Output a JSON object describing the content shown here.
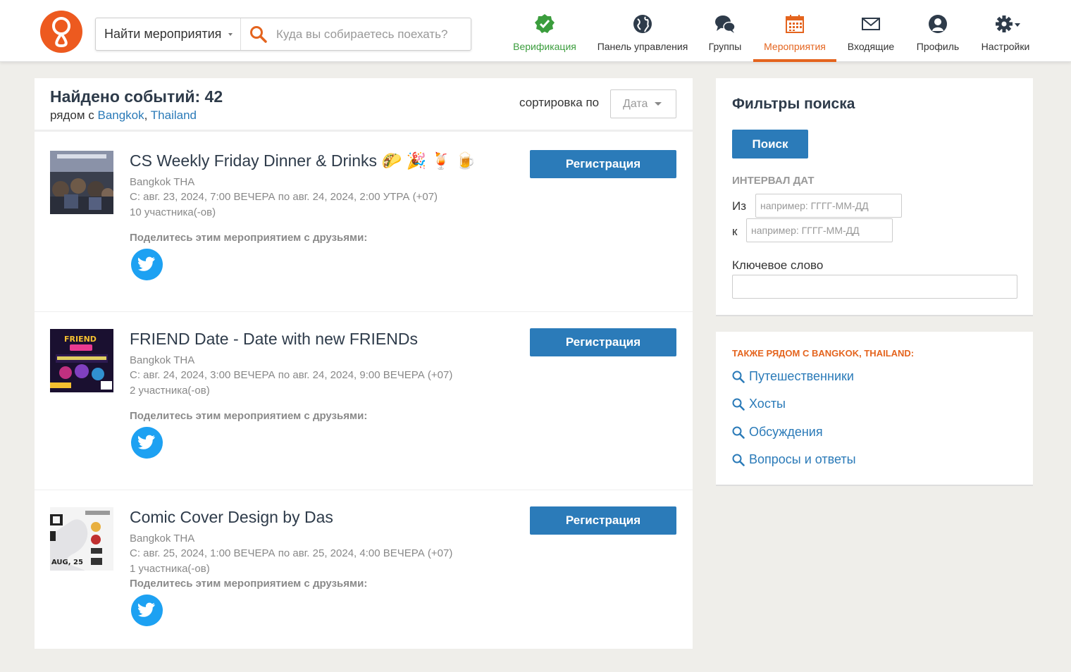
{
  "header": {
    "search_select": "Найти мероприятия",
    "search_placeholder": "Куда вы собираетесь поехать?",
    "nav": [
      {
        "label": "Верификация"
      },
      {
        "label": "Панель управления"
      },
      {
        "label": "Группы"
      },
      {
        "label": "Мероприятия"
      },
      {
        "label": "Входящие"
      },
      {
        "label": "Профиль"
      },
      {
        "label": "Настройки"
      }
    ],
    "colors": {
      "brand": "#ed5a1f",
      "active": "#e4641e",
      "verified": "#3b9d3d",
      "link": "#2a7ab8"
    }
  },
  "results": {
    "title": "Найдено событий: 42",
    "near_prefix": "рядом с ",
    "near_city": "Bangkok",
    "near_sep": ", ",
    "near_country": "Thailand",
    "sort_label": "сортировка по",
    "sort_value": "Дата"
  },
  "events": [
    {
      "title": "CS Weekly Friday Dinner & Drinks 🌮 🎉 🍹 🍺",
      "location": "Bangkok THA",
      "dates": "С: авг. 23, 2024, 7:00 ВЕЧЕРА по авг. 24, 2024, 2:00 УТРА (+07)",
      "attendees": "10 участника(-ов)",
      "share": "Поделитесь этим мероприятием с друзьями:",
      "register": "Регистрация"
    },
    {
      "title": "FRIEND Date - Date with new FRIENDs",
      "location": "Bangkok THA",
      "dates": "С: авг. 24, 2024, 3:00 ВЕЧЕРА по авг. 24, 2024, 9:00 ВЕЧЕРА (+07)",
      "attendees": "2 участника(-ов)",
      "share": "Поделитесь этим мероприятием с друзьями:",
      "register": "Регистрация"
    },
    {
      "title": "Comic Cover Design by Das",
      "location": "Bangkok THA",
      "dates": "С: авг. 25, 2024, 1:00 ВЕЧЕРА по авг. 25, 2024, 4:00 ВЕЧЕРА (+07)",
      "attendees": "1 участника(-ов)",
      "share": "Поделитесь этим мероприятием с друзьями:",
      "register": "Регистрация"
    }
  ],
  "filters": {
    "title": "Фильтры поиска",
    "search_button": "Поиск",
    "date_interval": "ИНТЕРВАЛ ДАТ",
    "from_label": "Из",
    "to_label": "к",
    "date_placeholder": "например: ГГГГ-ММ-ДД",
    "keyword_label": "Ключевое слово"
  },
  "nearby": {
    "heading": "ТАКЖЕ РЯДОМ С BANGKOK, THAILAND:",
    "links": [
      {
        "label": "Путешественники"
      },
      {
        "label": "Хосты"
      },
      {
        "label": "Обсуждения"
      },
      {
        "label": "Вопросы и ответы"
      }
    ]
  }
}
